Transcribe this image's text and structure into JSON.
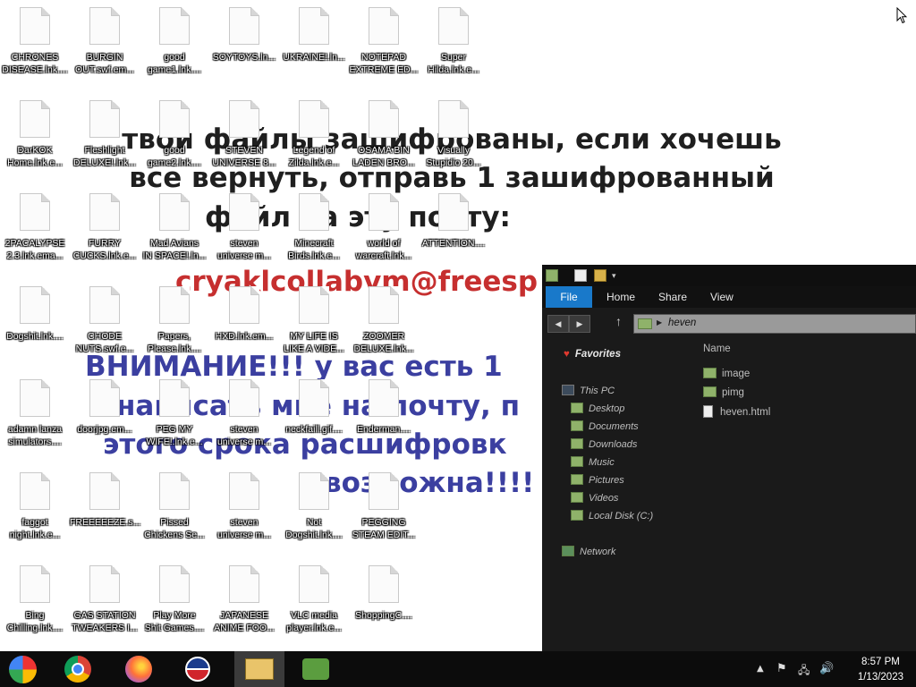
{
  "wallpaper": {
    "line1": "твои файлы зашифрованы, если хочешь",
    "line2": "все вернуть, отправь 1 зашифрованный",
    "line3": "файл на эту почту:",
    "email": "cryaklcollabvm@freesp",
    "line4": "ВНИМАНИЕ!!! у вас есть 1",
    "line5": "написать мне на почту, п",
    "line6": "этого срока расшифровк",
    "line7": "возможна!!!!"
  },
  "desktop_icons": [
    {
      "label": "CHRONES\nDISEASE.lnk...."
    },
    {
      "label": "BURGIN\nOUT.swf.em..."
    },
    {
      "label": "good\ngame1.lnk...."
    },
    {
      "label": "SOYTOYS.ln..."
    },
    {
      "label": "UKRAINE!.ln..."
    },
    {
      "label": "NOTEPAD\nEXTREME ED..."
    },
    {
      "label": "Super\nHilda.lnk.e..."
    },
    {
      "label": "DarKOK\nHome.lnk.e..."
    },
    {
      "label": "Fleshlight\nDELUXE!.lnk..."
    },
    {
      "label": "good\ngame2.lnk...."
    },
    {
      "label": "STEVEN\nUNIVERSE 8..."
    },
    {
      "label": "Legend of\nZilda.lnk.e..."
    },
    {
      "label": "OSAMA BIN\nLADEN BRO..."
    },
    {
      "label": "Visually\nStupidio 20..."
    },
    {
      "label": "2PACALYPSE\n2.3.lnk.ema..."
    },
    {
      "label": "FURRY\nCUCKS.lnk.e..."
    },
    {
      "label": "Mad Avians\nIN SPACE!.ln..."
    },
    {
      "label": "steven\nuniverse m..."
    },
    {
      "label": "Minecraft\nBirds.lnk.e..."
    },
    {
      "label": "world of\nwarcraft.lnk..."
    },
    {
      "label": "ATTENTION...."
    },
    {
      "label": "Dogshit.lnk...."
    },
    {
      "label": "CHODE\nNUTS.swf.e..."
    },
    {
      "label": "Papers,\nPlease.lnk...."
    },
    {
      "label": "HXD.lnk.em..."
    },
    {
      "label": "MY LIFE IS\nLIKE A VIDE..."
    },
    {
      "label": "ZOOMER\nDELUXE.lnk..."
    },
    {
      "label": "adamn lanza\nsimulators...."
    },
    {
      "label": "doorjpg.em..."
    },
    {
      "label": "PEG MY\nWIFE!.lnk.e..."
    },
    {
      "label": "steven\nuniverse m..."
    },
    {
      "label": "neckfaill.gif...."
    },
    {
      "label": "Enderman...."
    },
    {
      "label": "faggot\nnight.lnk.e..."
    },
    {
      "label": "FREEEEEZE.s..."
    },
    {
      "label": "Pissed\nChickens Se..."
    },
    {
      "label": "steven\nuniverse m..."
    },
    {
      "label": "Not\nDogshit.lnk...."
    },
    {
      "label": "PEGGING\nSTEAM EDIT..."
    },
    {
      "label": "Bing\nChilling.lnk...."
    },
    {
      "label": "GAS STATION\nTWEAKERS I..."
    },
    {
      "label": "Play More\nShit Games...."
    },
    {
      "label": "JAPANESE\nANIME FOO..."
    },
    {
      "label": "VLC media\nplayer.lnk.e..."
    },
    {
      "label": "ShoppingC...."
    }
  ],
  "explorer": {
    "ribbon_tabs": [
      "File",
      "Home",
      "Share",
      "View"
    ],
    "breadcrumb": "heven",
    "nav": {
      "favorites": "Favorites",
      "this_pc": "This PC",
      "items": [
        "Desktop",
        "Documents",
        "Downloads",
        "Music",
        "Pictures",
        "Videos",
        "Local Disk (C:)"
      ],
      "network": "Network"
    },
    "column_header": "Name",
    "files": [
      {
        "name": "image",
        "kind": "folder"
      },
      {
        "name": "pimg",
        "kind": "folder"
      },
      {
        "name": "heven.html",
        "kind": "file"
      }
    ]
  },
  "taskbar": {
    "apps": [
      "start-icon",
      "chrome-icon",
      "firefox-icon",
      "obama-logo-icon",
      "file-explorer-icon",
      "network-people-icon"
    ],
    "time": "8:57 PM",
    "date": "1/13/2023"
  }
}
